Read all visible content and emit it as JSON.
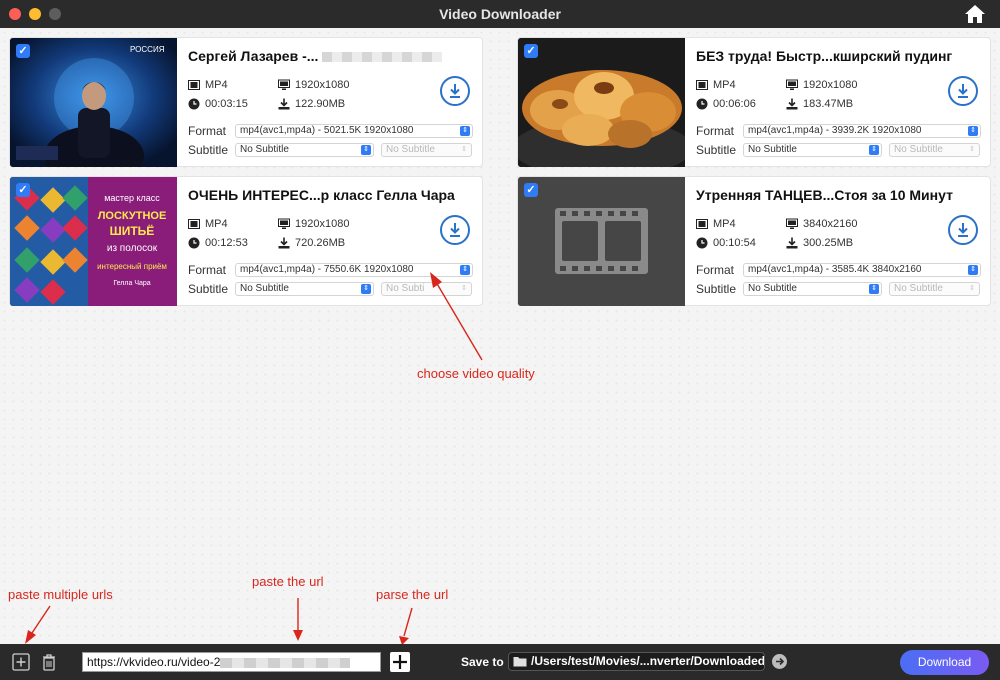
{
  "window": {
    "title": "Video Downloader"
  },
  "videos": [
    {
      "title": "Сергей Лазарев -...",
      "container": "MP4",
      "resolution": "1920x1080",
      "duration": "00:03:15",
      "size": "122.90MB",
      "format_label": "Format",
      "format_value": "mp4(avc1,mp4a) - 5021.5K 1920x1080",
      "subtitle_label": "Subtitle",
      "subtitle_value": "No Subtitle",
      "subtitle_lang": "No Subtitle",
      "thumbnail": "singer-on-stage"
    },
    {
      "title": "БЕЗ труда! Быстр...кширский пудинг",
      "container": "MP4",
      "resolution": "1920x1080",
      "duration": "00:06:06",
      "size": "183.47MB",
      "format_label": "Format",
      "format_value": "mp4(avc1,mp4a) - 3939.2K 1920x1080",
      "subtitle_label": "Subtitle",
      "subtitle_value": "No Subtitle",
      "subtitle_lang": "No Subtitle",
      "thumbnail": "yorkshire-pudding"
    },
    {
      "title": "ОЧЕНЬ ИНТЕРЕС...р класс Гелла Чара",
      "container": "MP4",
      "resolution": "1920x1080",
      "duration": "00:12:53",
      "size": "720.26MB",
      "format_label": "Format",
      "format_value": "mp4(avc1,mp4a) - 7550.6K 1920x1080",
      "subtitle_label": "Subtitle",
      "subtitle_value": "No Subtitle",
      "subtitle_lang": "No Subti",
      "thumbnail": "patchwork-masterclass",
      "thumb_text": [
        "мастер класс",
        "ЛОСКУТНОЕ",
        "ШИТЬЁ",
        "из полосок",
        "интересный приём",
        "Гелла Чара"
      ]
    },
    {
      "title": "Утренняя ТАНЦЕВ...Стоя за 10 Минут",
      "container": "MP4",
      "resolution": "3840x2160",
      "duration": "00:10:54",
      "size": "300.25MB",
      "format_label": "Format",
      "format_value": "mp4(avc1,mp4a) - 3585.4K 3840x2160",
      "subtitle_label": "Subtitle",
      "subtitle_value": "No Subtitle",
      "subtitle_lang": "No Subtitle",
      "thumbnail": "film-placeholder"
    }
  ],
  "annotations": {
    "quality": "choose video quality",
    "multi": "paste multiple urls",
    "paste": "paste the url",
    "parse": "parse the url"
  },
  "bottom": {
    "url_value": "https://vkvideo.ru/video-2",
    "save_to_label": "Save to",
    "save_path": "/Users/test/Movies/...nverter/Downloaded",
    "download_label": "Download"
  },
  "colors": {
    "accent": "#2f7cf6",
    "download_ring": "#2a72c9",
    "annotation": "#d9261c"
  }
}
